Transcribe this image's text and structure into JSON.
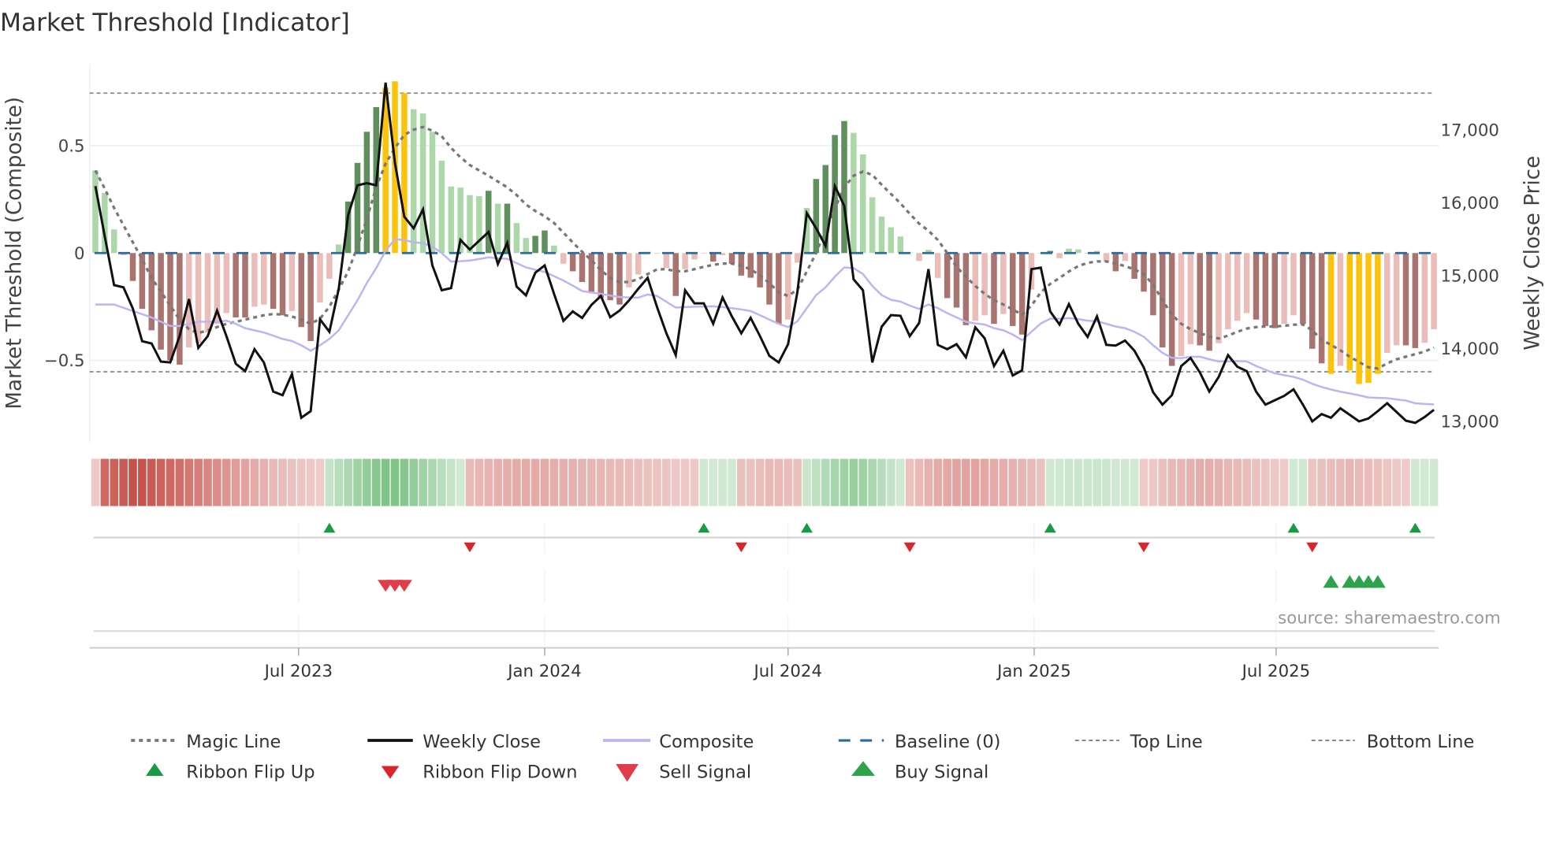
{
  "title": "Market Threshold [Indicator]",
  "source": "source: sharemaestro.com",
  "colors": {
    "light_green": "#acd7a8",
    "dark_green": "#5f8f5c",
    "light_red": "#ebbdb9",
    "dark_red": "#a9736f",
    "yellow": "#fbc30a",
    "weekly_close": "#111111",
    "composite": "#bdb5ef",
    "magic": "#777777",
    "baseline": "#2b6c9c",
    "ribbon_red": "#c8534c",
    "ribbon_green": "#6dbb76",
    "flip_up": "#1a9a44",
    "flip_down": "#d9262a",
    "sell": "#e03c4a",
    "buy": "#2ea34c"
  },
  "legend": {
    "magic_line": "Magic Line",
    "weekly_close": "Weekly Close",
    "composite": "Composite",
    "baseline": "Baseline (0)",
    "top_line": "Top Line",
    "bottom_line": "Bottom Line",
    "ribbon_flip_up": "Ribbon Flip Up",
    "ribbon_flip_down": "Ribbon Flip Down",
    "sell_signal": "Sell Signal",
    "buy_signal": "Buy Signal"
  },
  "chart_data": {
    "type": "bar",
    "title": "Market Threshold [Indicator]",
    "ylabel": "Market Threshold (Composite)",
    "y2label": "Weekly Close Price",
    "ylim": [
      -0.88,
      0.9
    ],
    "y2lim": [
      12000,
      18000
    ],
    "left_ticks": [
      {
        "value": 0.5,
        "label": "0.5"
      },
      {
        "value": 0,
        "label": "0"
      },
      {
        "value": -0.5,
        "label": "−0.5"
      }
    ],
    "right_ticks": [
      {
        "value": 17000,
        "label": "17,000"
      },
      {
        "value": 16000,
        "label": "16,000"
      },
      {
        "value": 15000,
        "label": "15,000"
      },
      {
        "value": 14000,
        "label": "14,000"
      },
      {
        "value": 13000,
        "label": "13,000"
      }
    ],
    "x_ticks": [
      {
        "week": 21.71,
        "label": "Jul 2023"
      },
      {
        "week": 48.0,
        "label": "Jan 2024"
      },
      {
        "week": 74.0,
        "label": "Jul 2024"
      },
      {
        "week": 100.29,
        "label": "Jan 2025"
      },
      {
        "week": 126.14,
        "label": "Jul 2025"
      }
    ],
    "top_line": 0.745,
    "bottom_line": -0.553,
    "baseline": 0,
    "composite_bars": [
      0.385,
      0.28,
      0.11,
      -0.01,
      -0.13,
      -0.26,
      -0.36,
      -0.45,
      -0.5,
      -0.52,
      -0.44,
      -0.42,
      -0.37,
      -0.33,
      -0.28,
      -0.3,
      -0.3,
      -0.25,
      -0.24,
      -0.26,
      -0.29,
      -0.27,
      -0.345,
      -0.41,
      -0.23,
      -0.12,
      0.04,
      0.24,
      0.42,
      0.565,
      0.68,
      0.77,
      0.8,
      0.745,
      0.67,
      0.65,
      0.565,
      0.43,
      0.31,
      0.305,
      0.27,
      0.265,
      0.29,
      0.23,
      0.23,
      0.14,
      0.07,
      0.08,
      0.105,
      0.035,
      -0.05,
      -0.085,
      -0.135,
      -0.18,
      -0.21,
      -0.22,
      -0.24,
      -0.16,
      -0.1,
      0.005,
      0.0,
      -0.07,
      -0.2,
      -0.075,
      -0.03,
      0.0,
      -0.04,
      -0.01,
      -0.05,
      -0.105,
      -0.115,
      -0.16,
      -0.24,
      -0.33,
      -0.31,
      -0.045,
      0.21,
      0.345,
      0.41,
      0.55,
      0.615,
      0.56,
      0.46,
      0.26,
      0.17,
      0.12,
      0.077,
      0.003,
      -0.037,
      0.015,
      -0.116,
      -0.21,
      -0.254,
      -0.336,
      -0.316,
      -0.29,
      -0.33,
      -0.284,
      -0.34,
      -0.38,
      -0.17,
      0.0,
      0.01,
      -0.024,
      0.02,
      0.017,
      0.0,
      0.01,
      -0.04,
      -0.085,
      -0.037,
      -0.12,
      -0.18,
      -0.29,
      -0.44,
      -0.526,
      -0.48,
      -0.425,
      -0.43,
      -0.455,
      -0.42,
      -0.355,
      -0.316,
      -0.28,
      -0.31,
      -0.34,
      -0.35,
      -0.33,
      -0.29,
      -0.33,
      -0.446,
      -0.514,
      -0.563,
      -0.526,
      -0.548,
      -0.61,
      -0.605,
      -0.563,
      -0.465,
      -0.43,
      -0.43,
      -0.443,
      -0.418,
      -0.355
    ],
    "bar_states": [
      "lg",
      "lg",
      "lg",
      "lr",
      "dr",
      "dr",
      "dr",
      "dr",
      "dr",
      "dr",
      "lr",
      "lr",
      "lr",
      "lr",
      "lr",
      "dr",
      "dr",
      "lr",
      "lr",
      "dr",
      "dr",
      "lr",
      "dr",
      "dr",
      "lr",
      "lr",
      "lg",
      "dg",
      "dg",
      "dg",
      "dg",
      "y",
      "y",
      "y",
      "lg",
      "lg",
      "lg",
      "lg",
      "lg",
      "lg",
      "lg",
      "lg",
      "dg",
      "lg",
      "dg",
      "lg",
      "lg",
      "dg",
      "dg",
      "lg",
      "lr",
      "dr",
      "dr",
      "dr",
      "dr",
      "dr",
      "dr",
      "lr",
      "lr",
      "dg",
      "lg",
      "lr",
      "dr",
      "lr",
      "lr",
      "lr",
      "dr",
      "lr",
      "dr",
      "dr",
      "dr",
      "dr",
      "dr",
      "dr",
      "lr",
      "lr",
      "lg",
      "dg",
      "dg",
      "dg",
      "dg",
      "lg",
      "lg",
      "lg",
      "lg",
      "lg",
      "lg",
      "lg",
      "lr",
      "lg",
      "lr",
      "dr",
      "dr",
      "dr",
      "lr",
      "lr",
      "dr",
      "lr",
      "dr",
      "dr",
      "lr",
      "lg",
      "dg",
      "lr",
      "lg",
      "lg",
      "lg",
      "lg",
      "lr",
      "dr",
      "lr",
      "dr",
      "dr",
      "dr",
      "dr",
      "dr",
      "lr",
      "lr",
      "dr",
      "dr",
      "lr",
      "lr",
      "lr",
      "lr",
      "dr",
      "dr",
      "dr",
      "lr",
      "lr",
      "dr",
      "dr",
      "dr",
      "y",
      "lr",
      "y",
      "y",
      "y",
      "y",
      "lr",
      "lr",
      "dr",
      "dr",
      "lr",
      "lr"
    ],
    "weekly_close": [
      16230,
      15540,
      14870,
      14840,
      14550,
      14100,
      14070,
      13820,
      13810,
      14170,
      14680,
      14010,
      14170,
      14520,
      14170,
      13790,
      13690,
      13990,
      13810,
      13410,
      13360,
      13650,
      13050,
      13140,
      14400,
      14230,
      14820,
      15830,
      16240,
      16270,
      16240,
      17650,
      16550,
      15810,
      15650,
      15910,
      15140,
      14800,
      14830,
      15490,
      15360,
      15480,
      15600,
      15160,
      15450,
      14850,
      14730,
      15040,
      15140,
      14750,
      14380,
      14510,
      14420,
      14600,
      14720,
      14430,
      14520,
      14660,
      14820,
      14970,
      14570,
      14210,
      13910,
      14800,
      14620,
      14620,
      14340,
      14700,
      14440,
      14210,
      14420,
      14170,
      13900,
      13810,
      14060,
      14780,
      15860,
      15650,
      15410,
      16230,
      15960,
      14950,
      14800,
      13810,
      14300,
      14460,
      14450,
      14170,
      14350,
      15090,
      14050,
      13990,
      14060,
      13880,
      14290,
      14140,
      13760,
      13970,
      13630,
      13700,
      15090,
      15110,
      14510,
      14330,
      14610,
      14340,
      14160,
      14440,
      14050,
      14040,
      14110,
      13970,
      13740,
      13400,
      13230,
      13360,
      13760,
      13870,
      13670,
      13410,
      13610,
      13910,
      13750,
      13690,
      13410,
      13230,
      13290,
      13350,
      13440,
      13230,
      13000,
      13100,
      13050,
      13180,
      13090,
      13000,
      13040,
      13140,
      13250,
      13130,
      13010,
      12980,
      13060,
      13160
    ],
    "composite": [
      -0.24,
      -0.24,
      -0.24,
      -0.255,
      -0.27,
      -0.285,
      -0.3,
      -0.32,
      -0.34,
      -0.34,
      -0.33,
      -0.32,
      -0.32,
      -0.32,
      -0.315,
      -0.33,
      -0.35,
      -0.36,
      -0.37,
      -0.385,
      -0.4,
      -0.41,
      -0.43,
      -0.455,
      -0.43,
      -0.4,
      -0.36,
      -0.29,
      -0.22,
      -0.14,
      -0.07,
      0.01,
      0.065,
      0.06,
      0.05,
      0.046,
      0.03,
      0.0,
      -0.04,
      -0.038,
      -0.035,
      -0.028,
      -0.02,
      -0.025,
      -0.027,
      -0.047,
      -0.067,
      -0.078,
      -0.088,
      -0.108,
      -0.128,
      -0.152,
      -0.177,
      -0.184,
      -0.19,
      -0.198,
      -0.205,
      -0.207,
      -0.208,
      -0.193,
      -0.2,
      -0.227,
      -0.254,
      -0.252,
      -0.25,
      -0.249,
      -0.248,
      -0.252,
      -0.257,
      -0.263,
      -0.27,
      -0.29,
      -0.31,
      -0.33,
      -0.345,
      -0.318,
      -0.257,
      -0.196,
      -0.16,
      -0.11,
      -0.067,
      -0.07,
      -0.098,
      -0.153,
      -0.196,
      -0.218,
      -0.226,
      -0.245,
      -0.26,
      -0.24,
      -0.257,
      -0.28,
      -0.3,
      -0.32,
      -0.328,
      -0.333,
      -0.35,
      -0.36,
      -0.38,
      -0.406,
      -0.367,
      -0.328,
      -0.306,
      -0.306,
      -0.303,
      -0.308,
      -0.315,
      -0.318,
      -0.33,
      -0.342,
      -0.35,
      -0.367,
      -0.39,
      -0.43,
      -0.465,
      -0.488,
      -0.49,
      -0.483,
      -0.483,
      -0.495,
      -0.505,
      -0.505,
      -0.503,
      -0.505,
      -0.526,
      -0.544,
      -0.56,
      -0.569,
      -0.577,
      -0.59,
      -0.609,
      -0.624,
      -0.636,
      -0.646,
      -0.654,
      -0.663,
      -0.673,
      -0.675,
      -0.676,
      -0.682,
      -0.687,
      -0.7,
      -0.703,
      -0.705
    ],
    "magic_line": [
      0.385,
      0.3,
      0.21,
      0.13,
      0.05,
      -0.03,
      -0.116,
      -0.18,
      -0.245,
      -0.31,
      -0.355,
      -0.373,
      -0.36,
      -0.345,
      -0.33,
      -0.32,
      -0.31,
      -0.3,
      -0.29,
      -0.284,
      -0.287,
      -0.296,
      -0.31,
      -0.33,
      -0.306,
      -0.25,
      -0.17,
      -0.086,
      0.03,
      0.16,
      0.306,
      0.416,
      0.49,
      0.55,
      0.575,
      0.587,
      0.57,
      0.544,
      0.49,
      0.446,
      0.41,
      0.385,
      0.36,
      0.333,
      0.306,
      0.27,
      0.226,
      0.196,
      0.171,
      0.14,
      0.095,
      0.049,
      0.006,
      -0.034,
      -0.08,
      -0.116,
      -0.135,
      -0.135,
      -0.122,
      -0.098,
      -0.076,
      -0.075,
      -0.085,
      -0.085,
      -0.075,
      -0.064,
      -0.055,
      -0.049,
      -0.049,
      -0.059,
      -0.076,
      -0.104,
      -0.14,
      -0.183,
      -0.2,
      -0.17,
      -0.086,
      0.0,
      0.11,
      0.208,
      0.306,
      0.36,
      0.38,
      0.364,
      0.318,
      0.275,
      0.232,
      0.183,
      0.137,
      0.104,
      0.061,
      0.0,
      -0.064,
      -0.11,
      -0.153,
      -0.19,
      -0.22,
      -0.24,
      -0.263,
      -0.287,
      -0.245,
      -0.183,
      -0.144,
      -0.116,
      -0.086,
      -0.061,
      -0.046,
      -0.039,
      -0.039,
      -0.049,
      -0.061,
      -0.076,
      -0.098,
      -0.147,
      -0.22,
      -0.287,
      -0.33,
      -0.355,
      -0.373,
      -0.389,
      -0.398,
      -0.385,
      -0.367,
      -0.352,
      -0.345,
      -0.342,
      -0.342,
      -0.339,
      -0.334,
      -0.333,
      -0.36,
      -0.404,
      -0.428,
      -0.453,
      -0.483,
      -0.508,
      -0.532,
      -0.538,
      -0.514,
      -0.495,
      -0.483,
      -0.471,
      -0.459,
      -0.44
    ],
    "ribbon_strength": [
      -0.2,
      -0.85,
      -0.9,
      -0.95,
      -1,
      -1,
      -0.95,
      -0.9,
      -0.85,
      -0.8,
      -0.75,
      -0.7,
      -0.65,
      -0.6,
      -0.55,
      -0.5,
      -0.45,
      -0.4,
      -0.35,
      -0.3,
      -0.28,
      -0.25,
      -0.22,
      -0.2,
      -0.18,
      0.3,
      0.4,
      0.5,
      0.6,
      0.7,
      0.8,
      0.85,
      0.85,
      0.8,
      0.7,
      0.6,
      0.5,
      0.4,
      0.3,
      0.2,
      -0.3,
      -0.32,
      -0.34,
      -0.36,
      -0.38,
      -0.4,
      -0.4,
      -0.4,
      -0.4,
      -0.38,
      -0.36,
      -0.35,
      -0.34,
      -0.33,
      -0.32,
      -0.3,
      -0.3,
      -0.28,
      -0.26,
      -0.25,
      -0.24,
      -0.22,
      -0.2,
      -0.2,
      -0.2,
      0.2,
      0.2,
      0.2,
      0.2,
      -0.25,
      -0.25,
      -0.28,
      -0.3,
      -0.3,
      -0.28,
      -0.25,
      0.25,
      0.35,
      0.45,
      0.55,
      0.6,
      0.65,
      0.6,
      0.5,
      0.4,
      0.3,
      0.2,
      -0.25,
      -0.3,
      -0.35,
      -0.4,
      -0.42,
      -0.45,
      -0.45,
      -0.45,
      -0.42,
      -0.4,
      -0.38,
      -0.35,
      -0.33,
      -0.3,
      -0.25,
      0.2,
      0.22,
      0.25,
      0.25,
      0.25,
      0.25,
      0.25,
      0.22,
      0.2,
      0.2,
      -0.18,
      -0.2,
      -0.25,
      -0.3,
      -0.32,
      -0.35,
      -0.38,
      -0.38,
      -0.35,
      -0.32,
      -0.3,
      -0.28,
      -0.25,
      -0.22,
      -0.2,
      -0.18,
      0.2,
      0.2,
      -0.22,
      -0.25,
      -0.28,
      -0.3,
      -0.32,
      -0.3,
      -0.28,
      -0.25,
      -0.22,
      -0.2,
      -0.18,
      0.2,
      0.2,
      0.2
    ],
    "ribbon_flip_up_weeks": [
      25,
      65,
      76,
      102,
      128,
      141
    ],
    "ribbon_flip_down_weeks": [
      40,
      69,
      87,
      112,
      130
    ],
    "sell_signal_weeks": [
      31,
      32,
      33
    ],
    "buy_signal_weeks": [
      132,
      134,
      135,
      136,
      137
    ],
    "legend_position": "bottom"
  }
}
